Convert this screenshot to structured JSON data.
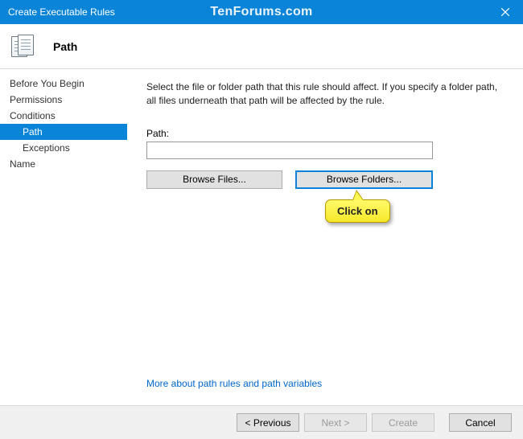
{
  "window": {
    "title": "Create Executable Rules",
    "watermark": "TenForums.com"
  },
  "header": {
    "title": "Path"
  },
  "sidebar": {
    "items": [
      {
        "label": "Before You Begin",
        "selected": false,
        "sub": false
      },
      {
        "label": "Permissions",
        "selected": false,
        "sub": false
      },
      {
        "label": "Conditions",
        "selected": false,
        "sub": false
      },
      {
        "label": "Path",
        "selected": true,
        "sub": true
      },
      {
        "label": "Exceptions",
        "selected": false,
        "sub": true
      },
      {
        "label": "Name",
        "selected": false,
        "sub": false
      }
    ]
  },
  "content": {
    "instruction": "Select the file or folder path that this rule should affect. If you specify a folder path, all files underneath that path will be affected by the rule.",
    "path_label": "Path:",
    "path_value": "",
    "browse_files_label": "Browse Files...",
    "browse_folders_label": "Browse Folders...",
    "more_link": "More about path rules and path variables"
  },
  "callout": {
    "text": "Click on"
  },
  "footer": {
    "previous": "< Previous",
    "next": "Next >",
    "create": "Create",
    "cancel": "Cancel"
  }
}
